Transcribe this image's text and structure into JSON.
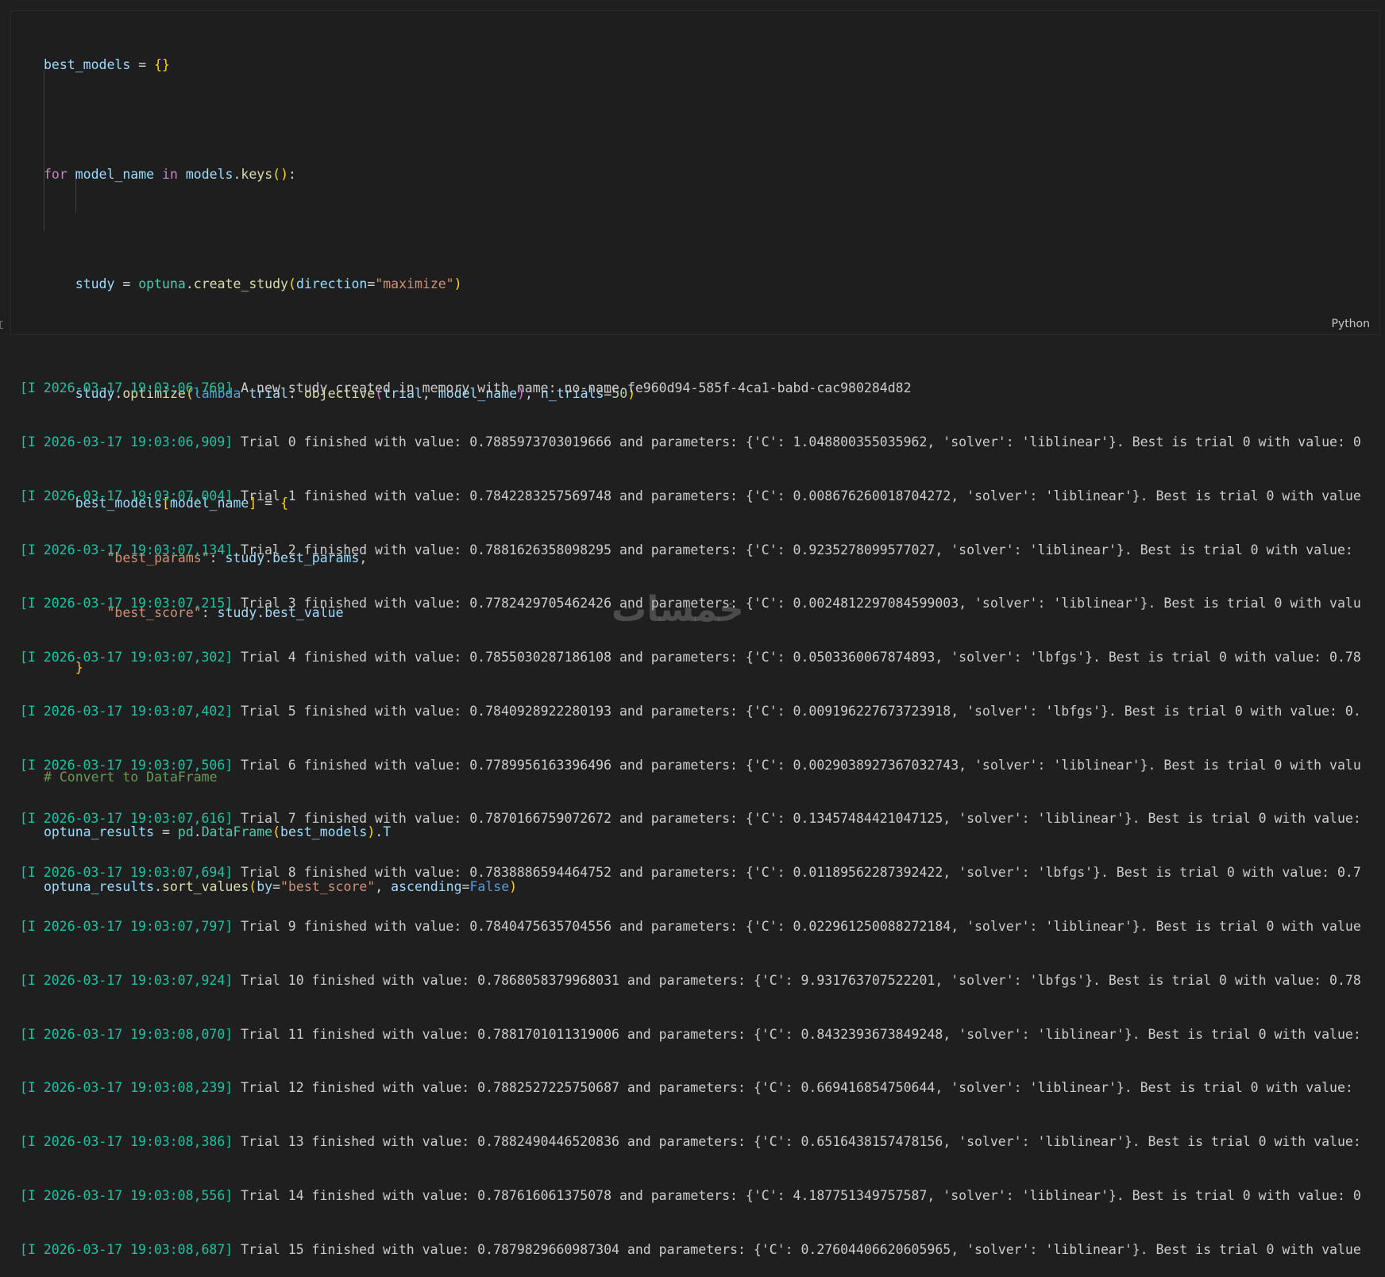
{
  "cell": {
    "language_label": "Python",
    "code": {
      "l1": {
        "var": "best_models",
        "eq": " = ",
        "braces": "{}"
      },
      "l2": {
        "kw_for": "for",
        "var": "model_name",
        "kw_in": " in ",
        "obj": "models",
        "dot": ".",
        "fn": "keys",
        "par": "()",
        "colon": ":"
      },
      "l3": {
        "var": "study",
        "eq": " = ",
        "mod": "optuna",
        "dot": ".",
        "fn": "create_study",
        "po": "(",
        "param": "direction",
        "eqs": "=",
        "str": "\"maximize\"",
        "pc": ")"
      },
      "l4": {
        "var": "study",
        "dot": ".",
        "fn": "optimize",
        "po": "(",
        "lam": "lambda",
        "arg": " trial",
        "colon": ": ",
        "fn2": "objective",
        "po2": "(",
        "a1": "trial",
        "comma": ", ",
        "a2": "model_name",
        "pc2": ")",
        "comma2": ", ",
        "param": "n_trials",
        "eqs": "=",
        "num": "50",
        "pc": ")"
      },
      "l5": {
        "var": "best_models",
        "bo": "[",
        "key": "model_name",
        "bc": "]",
        "eq": " = ",
        "open": "{"
      },
      "l6": {
        "str": "\"best_params\"",
        "colon": ": ",
        "obj": "study",
        "dot": ".",
        "attr": "best_params",
        "comma": ","
      },
      "l7": {
        "str": "\"best_score\"",
        "colon": ": ",
        "obj": "study",
        "dot": ".",
        "attr": "best_value"
      },
      "l8": {
        "close": "}"
      },
      "l9": {
        "comment": "# Convert to DataFrame"
      },
      "l10": {
        "var": "optuna_results",
        "eq": " = ",
        "mod": "pd",
        "dot": ".",
        "cls": "DataFrame",
        "po": "(",
        "arg": "best_models",
        "pc": ")",
        "dot2": ".",
        "attr": "T"
      },
      "l11": {
        "var": "optuna_results",
        "dot": ".",
        "fn": "sort_values",
        "po": "(",
        "p1": "by",
        "eqs": "=",
        "str": "\"best_score\"",
        "comma": ", ",
        "p2": "ascending",
        "eqs2": "=",
        "bool": "False",
        "pc": ")"
      }
    }
  },
  "output": {
    "rows": [
      {
        "ts": "[I 2026-03-17 19:03:06,769]",
        "msg": " A new study created in memory with name: no-name-fe960d94-585f-4ca1-babd-cac980284d82"
      },
      {
        "ts": "[I 2026-03-17 19:03:06,909]",
        "msg": " Trial 0 finished with value: 0.7885973703019666 and parameters: {'C': 1.048800355035962, 'solver': 'liblinear'}. Best is trial 0 with value: 0"
      },
      {
        "ts": "[I 2026-03-17 19:03:07,004]",
        "msg": " Trial 1 finished with value: 0.7842283257569748 and parameters: {'C': 0.008676260018704272, 'solver': 'liblinear'}. Best is trial 0 with value"
      },
      {
        "ts": "[I 2026-03-17 19:03:07,134]",
        "msg": " Trial 2 finished with value: 0.7881626358098295 and parameters: {'C': 0.9235278099577027, 'solver': 'liblinear'}. Best is trial 0 with value: "
      },
      {
        "ts": "[I 2026-03-17 19:03:07,215]",
        "msg": " Trial 3 finished with value: 0.7782429705462426 and parameters: {'C': 0.0024812297084599003, 'solver': 'liblinear'}. Best is trial 0 with valu"
      },
      {
        "ts": "[I 2026-03-17 19:03:07,302]",
        "msg": " Trial 4 finished with value: 0.7855030287186108 and parameters: {'C': 0.0503360067874893, 'solver': 'lbfgs'}. Best is trial 0 with value: 0.78"
      },
      {
        "ts": "[I 2026-03-17 19:03:07,402]",
        "msg": " Trial 5 finished with value: 0.7840928922280193 and parameters: {'C': 0.009196227673723918, 'solver': 'lbfgs'}. Best is trial 0 with value: 0."
      },
      {
        "ts": "[I 2026-03-17 19:03:07,506]",
        "msg": " Trial 6 finished with value: 0.7789956163396496 and parameters: {'C': 0.0029038927367032743, 'solver': 'liblinear'}. Best is trial 0 with valu"
      },
      {
        "ts": "[I 2026-03-17 19:03:07,616]",
        "msg": " Trial 7 finished with value: 0.7870166759072672 and parameters: {'C': 0.13457484421047125, 'solver': 'liblinear'}. Best is trial 0 with value:"
      },
      {
        "ts": "[I 2026-03-17 19:03:07,694]",
        "msg": " Trial 8 finished with value: 0.7838886594464752 and parameters: {'C': 0.01189562287392422, 'solver': 'lbfgs'}. Best is trial 0 with value: 0.7"
      },
      {
        "ts": "[I 2026-03-17 19:03:07,797]",
        "msg": " Trial 9 finished with value: 0.7840475635704556 and parameters: {'C': 0.022961250088272184, 'solver': 'liblinear'}. Best is trial 0 with value"
      },
      {
        "ts": "[I 2026-03-17 19:03:07,924]",
        "msg": " Trial 10 finished with value: 0.7868058379968031 and parameters: {'C': 9.931763707522201, 'solver': 'lbfgs'}. Best is trial 0 with value: 0.78"
      },
      {
        "ts": "[I 2026-03-17 19:03:08,070]",
        "msg": " Trial 11 finished with value: 0.7881701011319006 and parameters: {'C': 0.8432393673849248, 'solver': 'liblinear'}. Best is trial 0 with value:"
      },
      {
        "ts": "[I 2026-03-17 19:03:08,239]",
        "msg": " Trial 12 finished with value: 0.7882527225750687 and parameters: {'C': 0.669416854750644, 'solver': 'liblinear'}. Best is trial 0 with value: "
      },
      {
        "ts": "[I 2026-03-17 19:03:08,386]",
        "msg": " Trial 13 finished with value: 0.7882490446520836 and parameters: {'C': 0.6516438157478156, 'solver': 'liblinear'}. Best is trial 0 with value:"
      },
      {
        "ts": "[I 2026-03-17 19:03:08,556]",
        "msg": " Trial 14 finished with value: 0.787616061375078 and parameters: {'C': 4.187751349757587, 'solver': 'liblinear'}. Best is trial 0 with value: 0"
      },
      {
        "ts": "[I 2026-03-17 19:03:08,687]",
        "msg": " Trial 15 finished with value: 0.7879829660987304 and parameters: {'C': 0.27604406620605965, 'solver': 'liblinear'}. Best is trial 0 with value"
      }
    ]
  },
  "watermark": "خمسات"
}
